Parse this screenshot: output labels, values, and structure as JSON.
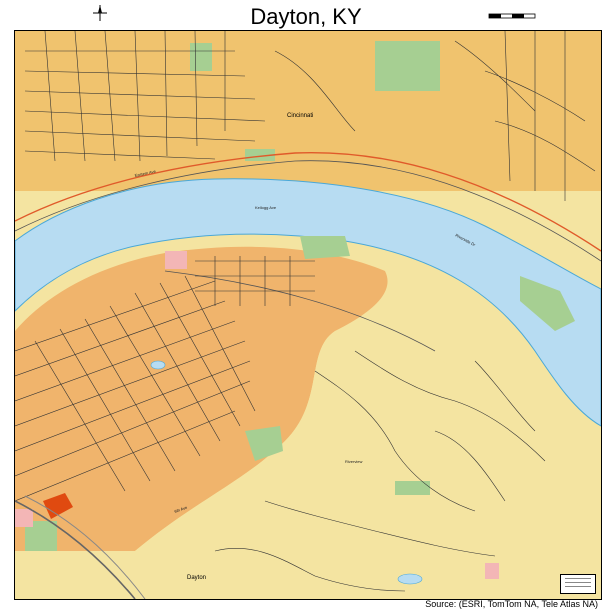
{
  "map": {
    "title": "Dayton, KY",
    "source_credit": "Source: (ESRI, TomTom NA, Tele Atlas NA)",
    "place_labels": [
      "Cincinnati",
      "Dayton"
    ],
    "road_labels": [
      "Riverside Dr",
      "Eastern Ave",
      "Kellogg Ave",
      "6th Ave",
      "Riverview"
    ],
    "colors": {
      "water": "#b7dcf2",
      "urban": "#f0b46c",
      "suburban": "#f4e4a1",
      "built_up": "#f0c36e",
      "park": "#a6cf92",
      "rail": "#e05a2a",
      "highlight": "#e04a10",
      "pink_block": "#f3b6b6"
    }
  }
}
